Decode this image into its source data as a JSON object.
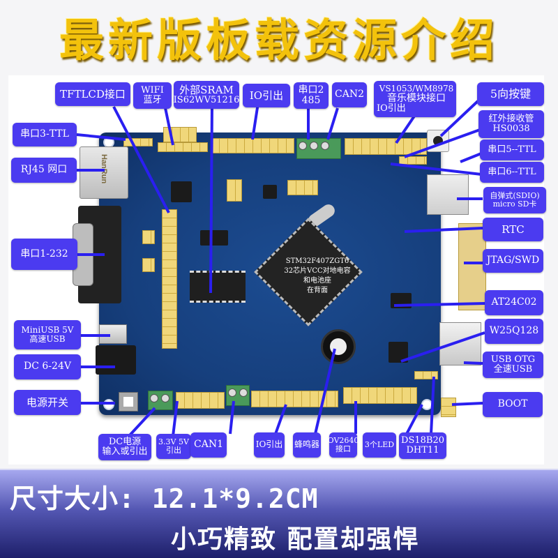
{
  "title": "最新版板载资源介绍",
  "board": {
    "mcu": {
      "part": "STM32F407ZGT6",
      "note_lines": [
        "32芯片VCC对地电容",
        "和电池座",
        "在背面"
      ]
    },
    "silkscreen": {
      "rj45_brand": "HanRun"
    }
  },
  "labels": {
    "tftlcd": [
      "TFTLCD接口"
    ],
    "wifi": [
      "WIFI",
      "蓝牙"
    ],
    "sram": [
      "外部SRAM",
      "IS62WV51216"
    ],
    "io_top": [
      "IO引出"
    ],
    "uart2": [
      "串口2",
      "485"
    ],
    "can2": [
      "CAN2"
    ],
    "music": [
      "VS1053/WM8978",
      "音乐模块接口",
      "IO引出"
    ],
    "key5": [
      "5向按键"
    ],
    "ir": [
      "红外接收管",
      "HS0038"
    ],
    "uart5": [
      "串口5--TTL"
    ],
    "uart6": [
      "串口6--TTL"
    ],
    "sd": [
      "自弹式(SDIO)",
      "micro SD卡"
    ],
    "rtc": [
      "RTC"
    ],
    "jtag": [
      "JTAG/SWD"
    ],
    "eeprom": [
      "AT24C02"
    ],
    "flash": [
      "W25Q128"
    ],
    "usb_otg": [
      "USB OTG",
      "全速USB"
    ],
    "boot": [
      "BOOT"
    ],
    "uart3": [
      "串口3-TTL"
    ],
    "rj45": [
      "RJ45 网口"
    ],
    "uart1": [
      "串口1-232"
    ],
    "miniusb": [
      "MiniUSB 5V",
      "高速USB"
    ],
    "dc": [
      "DC 6-24V"
    ],
    "power_switch": [
      "电源开关"
    ],
    "dc_io": [
      "DC电源",
      "输入或引出"
    ],
    "power_out": [
      "3.3V 5V",
      "引出"
    ],
    "can1": [
      "CAN1"
    ],
    "io_bottom": [
      "IO引出"
    ],
    "buzzer": [
      "蜂鸣器"
    ],
    "ov2640": [
      "OV2640",
      "接口"
    ],
    "led": [
      "3个LED"
    ],
    "ds18b20": [
      "DS18B20",
      "DHT11"
    ]
  },
  "footer": {
    "size": "尺寸大小: 12.1*9.2CM",
    "slogan": "小巧精致 配置却强悍"
  },
  "colors": {
    "label_bg": "#4b3bf0",
    "leader_line": "#2a1ff0",
    "title": "#f3c20c",
    "pcb": "#163f7d"
  }
}
